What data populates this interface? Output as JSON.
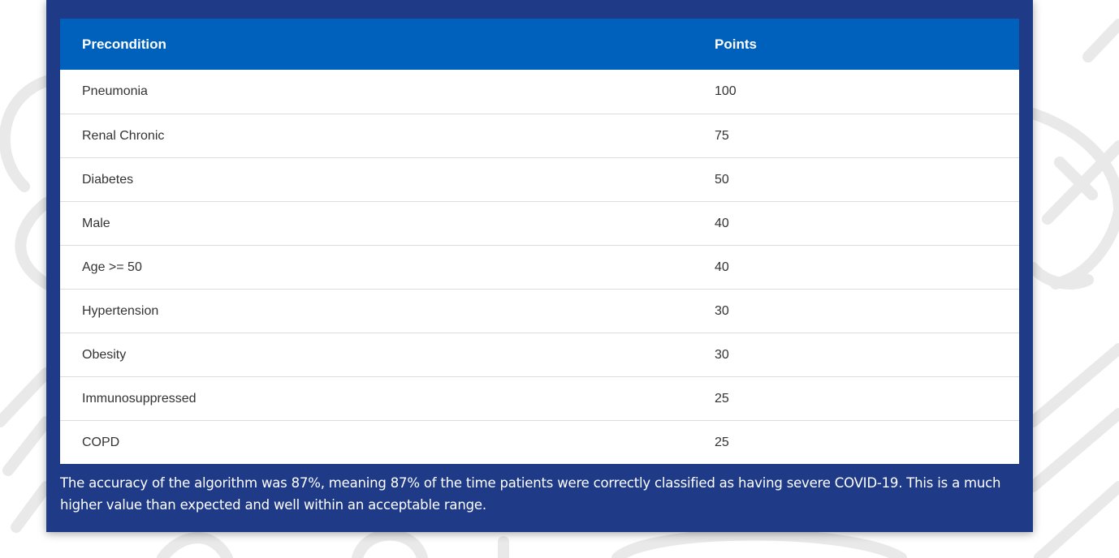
{
  "table": {
    "headers": [
      "Precondition",
      "Points"
    ],
    "rows": [
      [
        "Pneumonia",
        "100"
      ],
      [
        "Renal Chronic",
        "75"
      ],
      [
        "Diabetes",
        "50"
      ],
      [
        "Male",
        "40"
      ],
      [
        "Age >= 50",
        "40"
      ],
      [
        "Hypertension",
        "30"
      ],
      [
        "Obesity",
        "30"
      ],
      [
        "Immunosuppressed",
        "25"
      ],
      [
        "COPD",
        "25"
      ]
    ]
  },
  "footer": {
    "text": "The accuracy of the algorithm was 87%, meaning 87% of the time patients were correctly classified as having severe COVID-19. This is a much higher value than expected and well within an acceptable range."
  },
  "colors": {
    "card_bg": "#1f3b88",
    "header_bg": "#0061bd",
    "text": "#333333"
  }
}
